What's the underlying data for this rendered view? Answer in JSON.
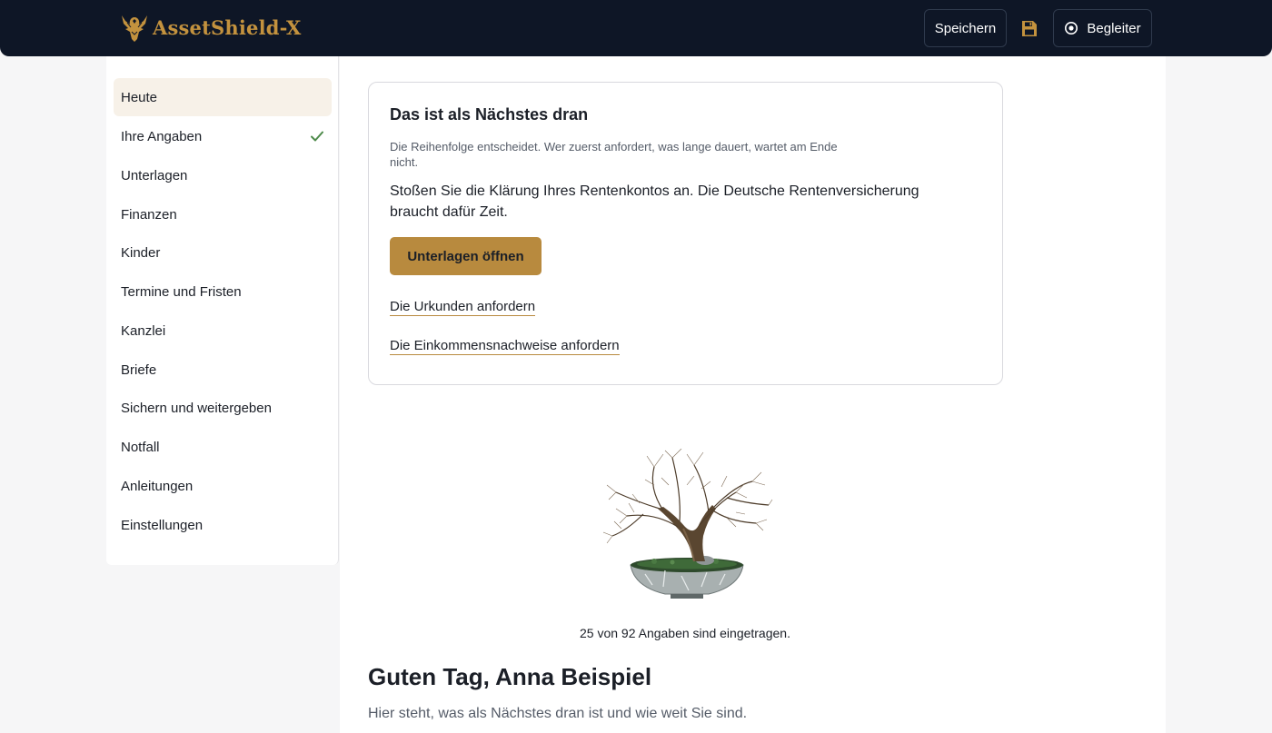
{
  "header": {
    "brand": "AssetShield-X",
    "save_label": "Speichern",
    "companion_label": "Begleiter"
  },
  "sidebar": {
    "items": [
      {
        "label": "Heute",
        "active": true
      },
      {
        "label": "Ihre Angaben",
        "done": true
      },
      {
        "label": "Unterlagen"
      },
      {
        "label": "Finanzen"
      },
      {
        "label": "Kinder"
      },
      {
        "label": "Termine und Fristen"
      },
      {
        "label": "Kanzlei"
      },
      {
        "label": "Briefe"
      },
      {
        "label": "Sichern und weitergeben"
      },
      {
        "label": "Notfall"
      },
      {
        "label": "Anleitungen"
      },
      {
        "label": "Einstellungen"
      }
    ]
  },
  "next_card": {
    "title": "Das ist als Nächstes dran",
    "subtitle": "Die Reihenfolge entscheidet. Wer zuerst anfordert, was lange dauert, wartet am Ende nicht.",
    "body": "Stoßen Sie die Klärung Ihres Rentenkontos an. Die Deutsche Rentenversicherung braucht dafür Zeit.",
    "primary_button": "Unterlagen öffnen",
    "links": [
      "Die Urkunden anfordern",
      "Die Einkommensnachweise anfordern"
    ]
  },
  "progress": {
    "text": "25 von 92 Angaben sind eingetragen.",
    "filled": 25,
    "total": 92
  },
  "greeting": {
    "title": "Guten Tag, Anna Beispiel",
    "subtitle": "Hier steht, was als Nächstes dran ist und wie weit Sie sind."
  },
  "colors": {
    "header_bg": "#0e1626",
    "accent": "#b88a3e",
    "brand": "#c3923e",
    "check": "#4d8a4a"
  },
  "icons": [
    "eagle-logo-icon",
    "floppy-disk-icon",
    "radio-target-icon",
    "checkmark-icon",
    "bonsai-tree-illustration"
  ]
}
